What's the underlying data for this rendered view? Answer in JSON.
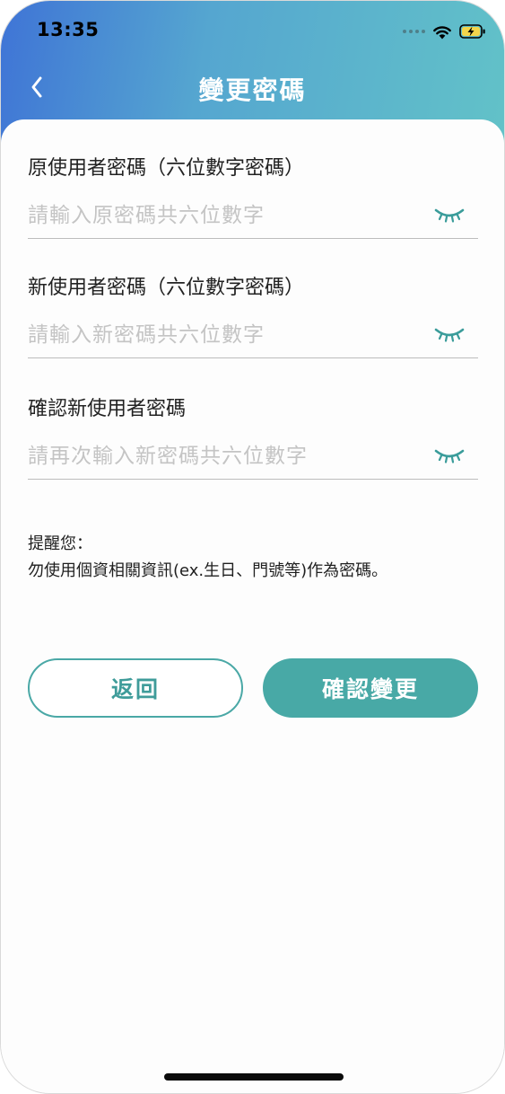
{
  "status_bar": {
    "time": "13:35"
  },
  "nav": {
    "title": "變更密碼",
    "back_icon": "chevron-left-icon"
  },
  "form": {
    "fields": [
      {
        "label": "原使用者密碼（六位數字密碼）",
        "placeholder": "請輸入原密碼共六位數字",
        "value": "",
        "icon": "eye-closed-icon"
      },
      {
        "label": "新使用者密碼（六位數字密碼）",
        "placeholder": "請輸入新密碼共六位數字",
        "value": "",
        "icon": "eye-closed-icon"
      },
      {
        "label": "確認新使用者密碼",
        "placeholder": "請再次輸入新密碼共六位數字",
        "value": "",
        "icon": "eye-closed-icon"
      }
    ]
  },
  "notice": {
    "title": "提醒您：",
    "text": "勿使用個資相關資訊(ex.生日、門號等)作為密碼。"
  },
  "buttons": {
    "back_label": "返回",
    "confirm_label": "確認變更"
  },
  "colors": {
    "header_gradient_start": "#3f74d6",
    "header_gradient_end": "#62c2c8",
    "accent": "#48a9a6",
    "placeholder": "#c4c4c4"
  }
}
